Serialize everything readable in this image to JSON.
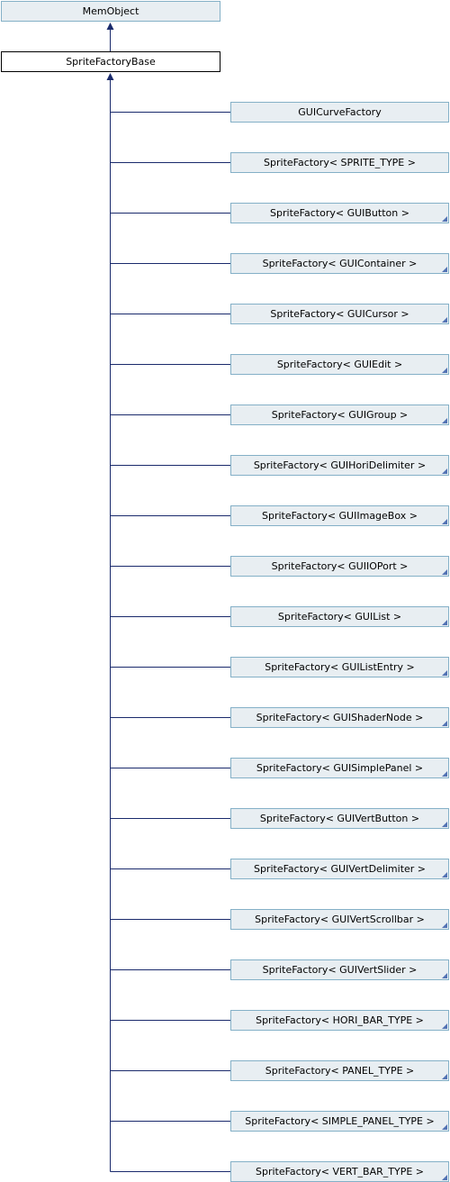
{
  "colors": {
    "edge": "#1a2a6c",
    "node_fill": "#e8eef2",
    "node_border": "#84b0c7",
    "focus_border": "#000000"
  },
  "diagram": {
    "base_class": {
      "label": "MemObject"
    },
    "focus_class": {
      "label": "SpriteFactoryBase"
    },
    "derived_classes": [
      {
        "label": "GUICurveFactory",
        "has_more": false
      },
      {
        "label": "SpriteFactory< SPRITE_TYPE >",
        "has_more": false
      },
      {
        "label": "SpriteFactory< GUIButton >",
        "has_more": true
      },
      {
        "label": "SpriteFactory< GUIContainer >",
        "has_more": true
      },
      {
        "label": "SpriteFactory< GUICursor >",
        "has_more": true
      },
      {
        "label": "SpriteFactory< GUIEdit >",
        "has_more": true
      },
      {
        "label": "SpriteFactory< GUIGroup >",
        "has_more": true
      },
      {
        "label": "SpriteFactory< GUIHoriDelimiter >",
        "has_more": true
      },
      {
        "label": "SpriteFactory< GUIImageBox >",
        "has_more": true
      },
      {
        "label": "SpriteFactory< GUIIOPort >",
        "has_more": true
      },
      {
        "label": "SpriteFactory< GUIList >",
        "has_more": true
      },
      {
        "label": "SpriteFactory< GUIListEntry >",
        "has_more": true
      },
      {
        "label": "SpriteFactory< GUIShaderNode >",
        "has_more": true
      },
      {
        "label": "SpriteFactory< GUISimplePanel >",
        "has_more": true
      },
      {
        "label": "SpriteFactory< GUIVertButton >",
        "has_more": true
      },
      {
        "label": "SpriteFactory< GUIVertDelimiter >",
        "has_more": true
      },
      {
        "label": "SpriteFactory< GUIVertScrollbar >",
        "has_more": true
      },
      {
        "label": "SpriteFactory< GUIVertSlider >",
        "has_more": true
      },
      {
        "label": "SpriteFactory< HORI_BAR_TYPE >",
        "has_more": true
      },
      {
        "label": "SpriteFactory< PANEL_TYPE >",
        "has_more": true
      },
      {
        "label": "SpriteFactory< SIMPLE_PANEL_TYPE >",
        "has_more": true
      },
      {
        "label": "SpriteFactory< VERT_BAR_TYPE >",
        "has_more": true
      }
    ]
  }
}
